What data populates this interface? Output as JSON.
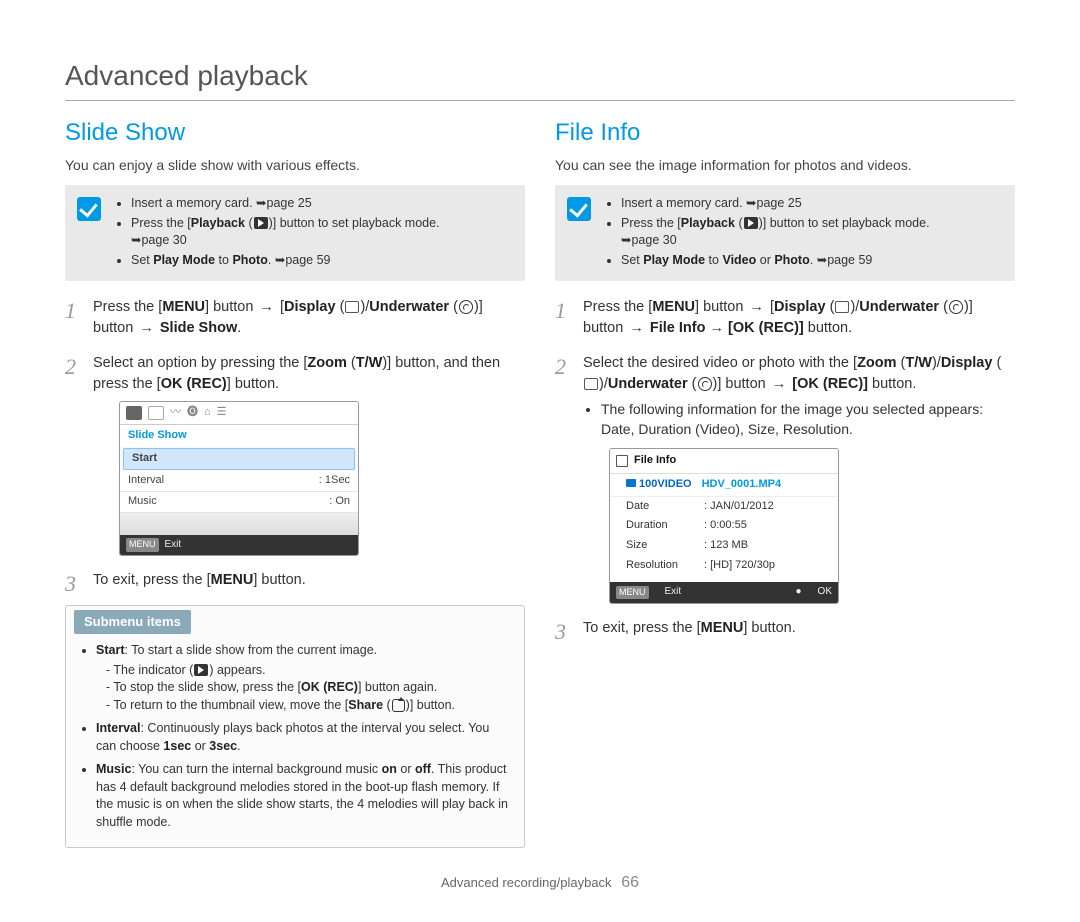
{
  "page": {
    "title": "Advanced playback",
    "footer_section": "Advanced recording/playback",
    "footer_page": "66"
  },
  "left": {
    "heading": "Slide Show",
    "intro": "You can enjoy a slide show with various effects.",
    "prereqs": {
      "p1_a": "Insert a memory card. ",
      "p1_b": "page 25",
      "p2_a": "Press the [",
      "p2_bold": "Playback",
      "p2_b": " (",
      "p2_c": ")] button to set playback mode.",
      "p2_d": "page 30",
      "p3_a": "Set ",
      "p3_b1": "Play Mode",
      "p3_mid": " to ",
      "p3_b2": "Photo",
      "p3_end": ". ",
      "p3_ref": "page 59"
    },
    "steps": {
      "s1_a": "Press the [",
      "s1_menu": "MENU",
      "s1_b": "] button ",
      "s1_arrow": "→",
      "s1_c": " [",
      "s1_disp": "Display",
      "s1_d": " (",
      "s1_e": ")/",
      "s1_under": "Underwater",
      "s1_f": " (",
      "s1_g": ")] button ",
      "s1_target": "Slide Show",
      "s1_h": ".",
      "s2_a": "Select an option by pressing the [",
      "s2_zoom": "Zoom",
      "s2_b": " (",
      "s2_tw": "T/W",
      "s2_c": ")] button, and then press the [",
      "s2_ok": "OK (REC)",
      "s2_d": "] button.",
      "s3_a": "To exit, press the [",
      "s3_menu": "MENU",
      "s3_b": "] button."
    },
    "osd": {
      "title": "Slide Show",
      "start": "Start",
      "interval_label": "Interval",
      "interval_value": "1Sec",
      "music_label": "Music",
      "music_value": "On",
      "exit_key": "MENU",
      "exit_label": "Exit"
    },
    "submenu": {
      "title": "Submenu items",
      "start_label": "Start",
      "start_text": ": To start a slide show from the current image.",
      "start_d1_a": "The indicator (",
      "start_d1_b": ") appears.",
      "start_d2_a": "To stop the slide show, press the [",
      "start_d2_ok": "OK (REC)",
      "start_d2_b": "] button again.",
      "start_d3_a": "To return to the thumbnail view, move the [",
      "start_d3_share": "Share",
      "start_d3_b": " (",
      "start_d3_c": ")] button.",
      "interval_label": "Interval",
      "interval_text_a": ": Continuously plays back photos at the interval you select. You can choose ",
      "interval_b1": "1sec",
      "interval_or": " or ",
      "interval_b2": "3sec",
      "interval_end": ".",
      "music_label": "Music",
      "music_text_a": ": You can turn the internal background music ",
      "music_on": "on",
      "music_mid": " or ",
      "music_off": "off",
      "music_text_b": ". This product has 4 default background melodies stored in the boot-up flash memory. If the music is on when the slide show starts, the 4 melodies will play back in shuffle mode."
    }
  },
  "right": {
    "heading": "File Info",
    "intro": "You can see the image information for photos and videos.",
    "prereqs": {
      "p1_a": "Insert a memory card. ",
      "p1_b": "page 25",
      "p2_a": "Press the [",
      "p2_bold": "Playback",
      "p2_b": " (",
      "p2_c": ")] button to set playback mode.",
      "p2_d": "page 30",
      "p3_a": "Set ",
      "p3_b1": "Play Mode",
      "p3_mid": " to ",
      "p3_b2": "Video",
      "p3_or": " or ",
      "p3_b3": "Photo",
      "p3_end": ". ",
      "p3_ref": "page 59"
    },
    "steps": {
      "s1_a": "Press the [",
      "s1_menu": "MENU",
      "s1_b": "] button ",
      "s1_arrow": "→",
      "s1_c": " [",
      "s1_disp": "Display",
      "s1_d": " (",
      "s1_e": ")/",
      "s1_under": "Underwater",
      "s1_f": " (",
      "s1_g": ")] button ",
      "s1_fi": "File Info",
      "s1_arrow2": " → ",
      "s1_ok": "[OK (REC)]",
      "s1_h": " button.",
      "s2_a": "Select the desired video or photo with the [",
      "s2_zoom": "Zoom",
      "s2_b": " (",
      "s2_tw": "T/W",
      "s2_c": ")/",
      "s2_disp": "Display",
      "s2_d": " (",
      "s2_e": ")/",
      "s2_under": "Underwater",
      "s2_f": " (",
      "s2_g": ")] button ",
      "s2_arrow": "→",
      "s2_ok": " [OK (REC)]",
      "s2_h": " button.",
      "s2_bullet": "The following information for the image you selected appears: Date, Duration (Video), Size, Resolution.",
      "s3_a": "To exit, press the [",
      "s3_menu": "MENU",
      "s3_b": "] button."
    },
    "osd": {
      "title": "File Info",
      "folder": "100VIDEO",
      "file": "HDV_0001.MP4",
      "rows": {
        "date_k": "Date",
        "date_v": "JAN/01/2012",
        "dur_k": "Duration",
        "dur_v": "0:00:55",
        "size_k": "Size",
        "size_v": "123 MB",
        "res_k": "Resolution",
        "res_v": "[HD] 720/30p"
      },
      "exit_key": "MENU",
      "exit_label": "Exit",
      "ok_icon": "●",
      "ok_label": "OK"
    }
  }
}
